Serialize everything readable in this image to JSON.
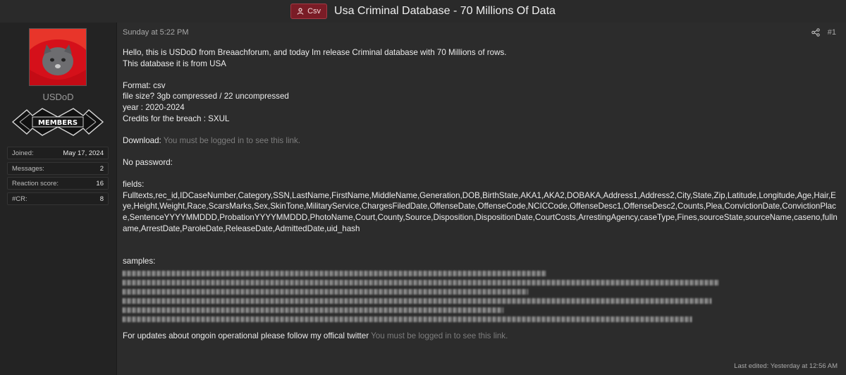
{
  "thread": {
    "prefix_label": "Csv",
    "title": "Usa Criminal Database - 70 Millions Of Data"
  },
  "author": {
    "username": "USDoD",
    "banner_text": "MEMBERS",
    "stats": [
      {
        "label": "Joined:",
        "value": "May 17, 2024"
      },
      {
        "label": "Messages:",
        "value": "2"
      },
      {
        "label": "Reaction score:",
        "value": "16"
      },
      {
        "label": "#CR:",
        "value": "8"
      }
    ]
  },
  "post": {
    "date": "Sunday at 5:22 PM",
    "number": "#1",
    "intro_1": "Hello, this is USDoD from Breaachforum, and today Im release Criminal database with 70 Millions of rows.",
    "intro_2": "This database it is from USA",
    "format": "Format: csv",
    "size": "file size? 3gb compressed / 22 uncompressed",
    "year": "year : 2020-2024",
    "credits": "Credits for the breach : SXUL",
    "download_label": "Download:",
    "locked_link": "You must be logged in to see this link.",
    "password": "No password:",
    "fields_label": "fields:",
    "fields_value": "Fulltexts,rec_id,IDCaseNumber,Category,SSN,LastName,FirstName,MiddleName,Generation,DOB,BirthState,AKA1,AKA2,DOBAKA,Address1,Address2,City,State,Zip,Latitude,Longitude,Age,Hair,Eye,Height,Weight,Race,ScarsMarks,Sex,SkinTone,MilitaryService,ChargesFiledDate,OffenseDate,OffenseCode,NCICCode,OffenseDesc1,OffenseDesc2,Counts,Plea,ConvictionDate,ConvictionPlace,SentenceYYYYMMDDD,ProbationYYYYMMDDD,PhotoName,Court,County,Source,Disposition,DispositionDate,CourtCosts,ArrestingAgency,caseType,Fines,sourceState,sourceName,caseno,fullname,ArrestDate,ParoleDate,ReleaseDate,AdmittedDate,uid_hash",
    "samples_label": "samples:",
    "updates_text": "For updates about ongoin operational please follow my offical twitter",
    "updates_link": "You must be logged in to see this link.",
    "last_edited": "Last edited: Yesterday at 12:56 AM"
  },
  "colors": {
    "prefix_bg": "#7a1c26",
    "muted_link": "#7d7d7d",
    "avatar_red": "#d5101a"
  }
}
